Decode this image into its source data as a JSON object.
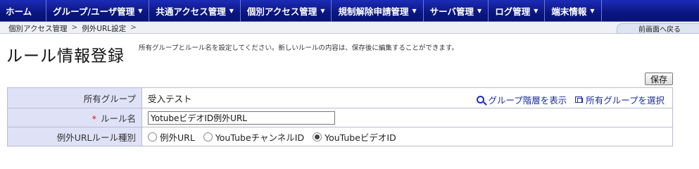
{
  "nav": {
    "items": [
      {
        "label": "ホーム",
        "dropdown": false
      },
      {
        "label": "グループ/ユーザ管理",
        "dropdown": true
      },
      {
        "label": "共通アクセス管理",
        "dropdown": true
      },
      {
        "label": "個別アクセス管理",
        "dropdown": true
      },
      {
        "label": "規制解除申請管理",
        "dropdown": true
      },
      {
        "label": "サーバ管理",
        "dropdown": true
      },
      {
        "label": "ログ管理",
        "dropdown": true
      },
      {
        "label": "端末情報",
        "dropdown": true
      }
    ],
    "caret": "▼"
  },
  "breadcrumb": {
    "items": [
      "個別アクセス管理",
      "例外URL設定"
    ],
    "separator": ">"
  },
  "back_link": "前画面へ戻る",
  "page": {
    "title": "ルール情報登録",
    "description": "所有グループとルール名を設定してください。新しいルールの内容は、保存後に編集することができます。"
  },
  "toolbar": {
    "save_label": "保存"
  },
  "form": {
    "group": {
      "label": "所有グループ",
      "value": "受入テスト",
      "show_hierarchy_link": "グループ階層を表示",
      "select_group_link": "所有グループを選択"
    },
    "rule_name": {
      "required_mark": "*",
      "label": "ルール名",
      "value": "YotubeビデオID例外URL"
    },
    "rule_type": {
      "label": "例外URLルール種別",
      "options": [
        {
          "label": "例外URL",
          "checked": false
        },
        {
          "label": "YouTubeチャンネルID",
          "checked": false
        },
        {
          "label": "YouTubeビデオID",
          "checked": true
        }
      ]
    }
  },
  "colors": {
    "nav_bg": "#0a1680",
    "label_bg": "#dfe1f7",
    "link": "#1a2e9a",
    "required": "#dd1111"
  }
}
